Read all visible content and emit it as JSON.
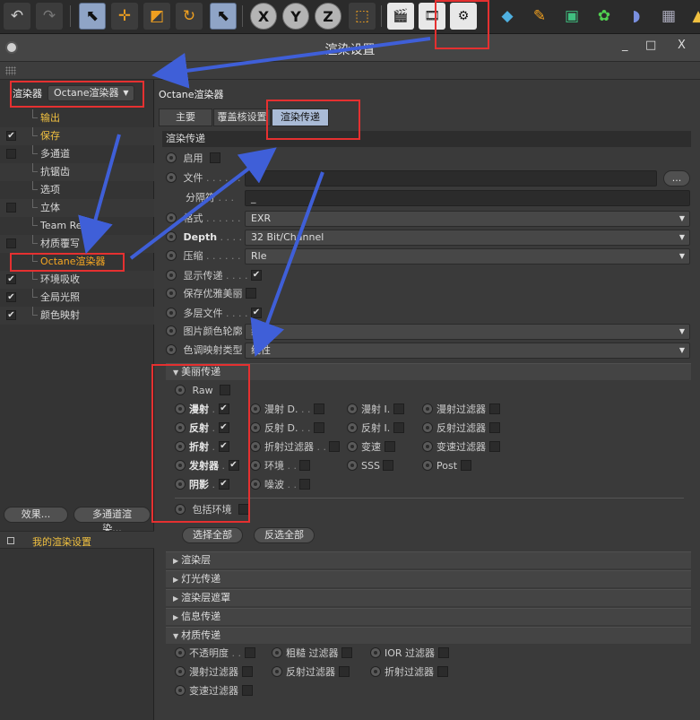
{
  "window": {
    "title": "渲染设置",
    "controls": [
      "_",
      "□",
      "X"
    ]
  },
  "left": {
    "renderer_label": "渲染器",
    "renderer_value": "Octane渲染器",
    "items": [
      {
        "label": "输出",
        "checked": null,
        "color": "gold"
      },
      {
        "label": "保存",
        "checked": true,
        "color": "gold"
      },
      {
        "label": "多通道",
        "checked": false,
        "color": "normal"
      },
      {
        "label": "抗锯齿",
        "checked": null,
        "color": "normal"
      },
      {
        "label": "选项",
        "checked": null,
        "color": "normal"
      },
      {
        "label": "立体",
        "checked": false,
        "color": "normal"
      },
      {
        "label": "Team Render",
        "checked": null,
        "color": "normal"
      },
      {
        "label": "材质覆写",
        "checked": false,
        "color": "normal"
      },
      {
        "label": "Octane渲染器",
        "checked": null,
        "color": "orange"
      },
      {
        "label": "环境吸收",
        "checked": true,
        "color": "normal"
      },
      {
        "label": "全局光照",
        "checked": true,
        "color": "normal"
      },
      {
        "label": "颜色映射",
        "checked": true,
        "color": "normal"
      }
    ],
    "effects_button": "效果...",
    "multipass_button": "多通道渲染...",
    "preset_label": "我的渲染设置"
  },
  "right": {
    "title": "Octane渲染器",
    "tabs": [
      "主要",
      "覆盖核设置",
      "渲染传递"
    ],
    "section_title": "渲染传递",
    "fields": {
      "enable_label": "启用",
      "file_label": "文件",
      "file_button": "...",
      "separator_label": "分隔符",
      "separator_value": "_",
      "format_label": "格式",
      "format_value": "EXR",
      "depth_label": "Depth",
      "depth_value": "32 Bit/Channel",
      "compress_label": "压缩",
      "compress_value": "Rle",
      "show_passes_label": "显示传递",
      "save_beauty_label": "保存优雅美丽",
      "multilayer_label": "多层文件",
      "color_profile_label": "图片颜色轮廓",
      "color_profile_value": "线性",
      "tonemap_label": "色调映射类型",
      "tonemap_value": "线性"
    },
    "beauty": {
      "title": "美丽传递",
      "raw": "Raw",
      "col1": [
        "漫射",
        "反射",
        "折射",
        "发射器",
        "阴影"
      ],
      "col2": [
        "漫射 D.",
        "反射 D.",
        "折射过滤器",
        "环境",
        "噪波"
      ],
      "col3": [
        "漫射 I.",
        "反射 I.",
        "变速",
        "SSS"
      ],
      "col4": [
        "漫射过滤器",
        "反射过滤器",
        "变速过滤器",
        "Post"
      ],
      "include_env": "包括环境",
      "select_all": "选择全部",
      "invert": "反选全部"
    },
    "groups": [
      "渲染层",
      "灯光传递",
      "渲染层遮罩",
      "信息传递",
      "材质传递"
    ],
    "material": {
      "row1": [
        "不透明度",
        "粗糙 过滤器",
        "IOR 过滤器"
      ],
      "row2": [
        "漫射过滤器",
        "反射过滤器",
        "折射过滤器"
      ],
      "row3": [
        "变速过滤器"
      ]
    }
  },
  "colors": {
    "annotation_red": "#e53030",
    "annotation_blue": "#3f5fd8",
    "active_tab": "#aabbd6",
    "highlight_text": "#f0c040"
  }
}
